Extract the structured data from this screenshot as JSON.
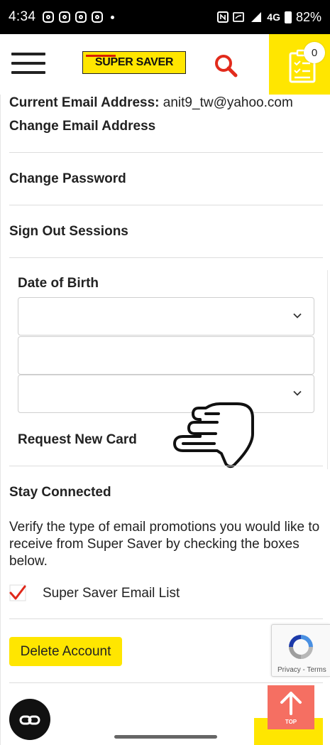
{
  "status_bar": {
    "time": "4:34",
    "network": "4G",
    "battery": "82%"
  },
  "header": {
    "logo_text": "SUPER SAVER",
    "cart_count": "0"
  },
  "account": {
    "current_email_label": "Current Email Address:",
    "current_email_value": "anit9_tw@yahoo.com",
    "change_email": "Change Email Address",
    "change_password": "Change Password",
    "sign_out_sessions": "Sign Out Sessions",
    "date_of_birth": "Date of Birth",
    "request_new_card": "Request New Card",
    "stay_connected": "Stay Connected",
    "verify_text": "Verify the type of email promotions you would like to receive from Super Saver by checking the boxes below.",
    "email_list_label": "Super Saver Email List",
    "email_list_checked": true,
    "delete_account": "Delete Account"
  },
  "recaptcha": {
    "links": "Privacy - Terms"
  },
  "top_button": {
    "label": "TOP"
  },
  "colors": {
    "brand_yellow": "#ffe600",
    "brand_red": "#d81e05",
    "top_button": "#f56f62"
  }
}
